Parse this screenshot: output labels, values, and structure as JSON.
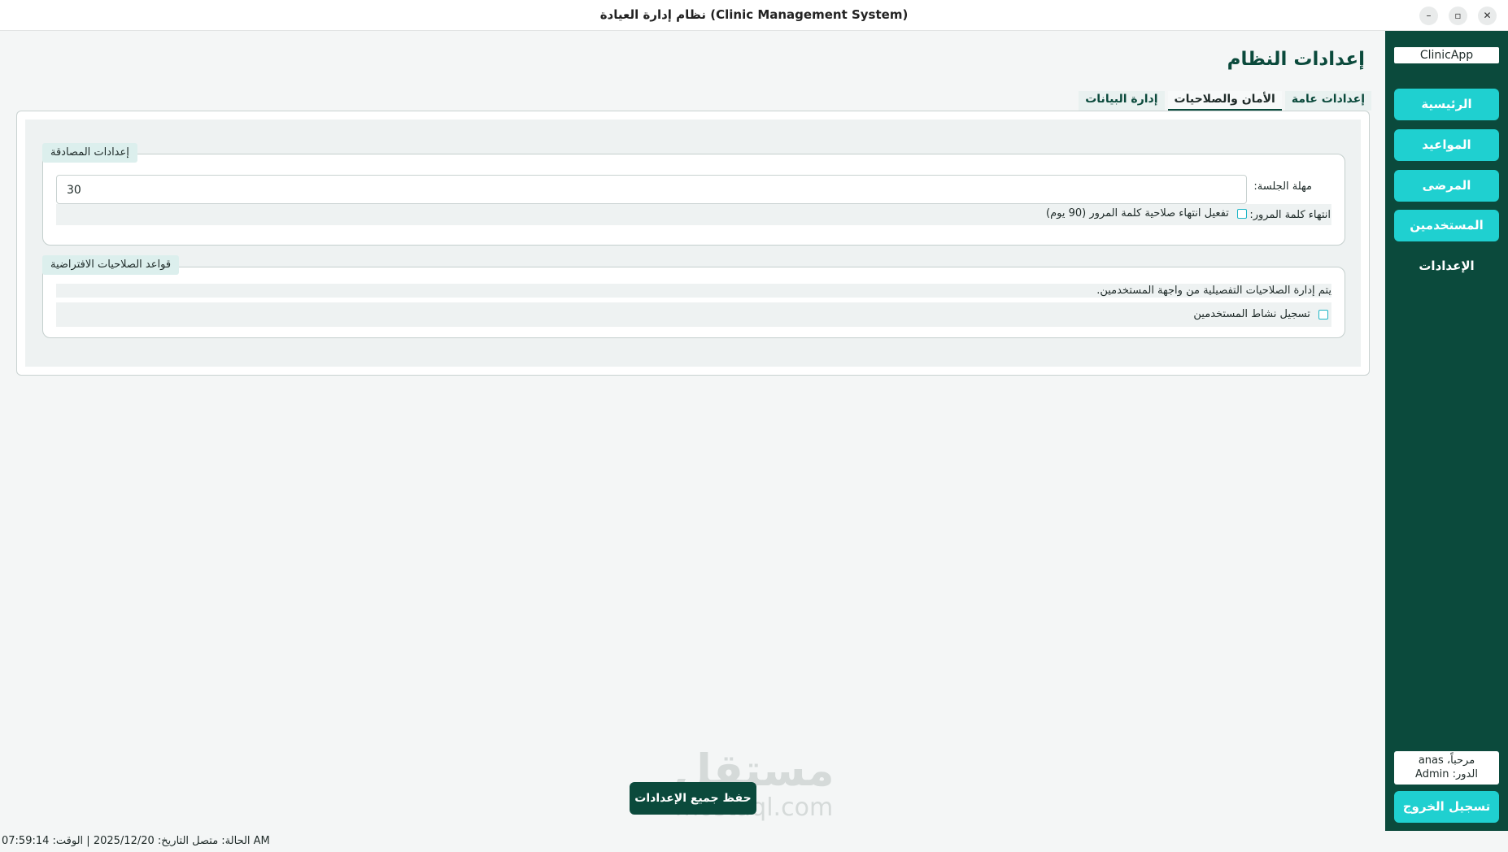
{
  "window": {
    "title": "نظام إدارة العيادة (Clinic Management System)",
    "minimize_glyph": "–",
    "maximize_glyph": "▫",
    "close_glyph": "✕"
  },
  "sidebar": {
    "brand": "ClinicApp",
    "items": [
      {
        "label": "الرئيسية"
      },
      {
        "label": "المواعيد"
      },
      {
        "label": "المرضى"
      },
      {
        "label": "المستخدمين"
      },
      {
        "label": "الإعدادات"
      }
    ],
    "user": {
      "welcome": "مرحباً، anas",
      "role": "الدور: Admin"
    },
    "logout_label": "تسجيل الخروج"
  },
  "page": {
    "title": "إعدادات النظام",
    "tabs": [
      {
        "label": "إعدادات عامة"
      },
      {
        "label": "الأمان والصلاحيات"
      },
      {
        "label": "إدارة البيانات"
      }
    ],
    "auth_group": {
      "legend": "إعدادات المصادقة",
      "session_label": "مهلة الجلسة:",
      "session_value": "30",
      "password_label": "انتهاء كلمة المرور:",
      "password_checkbox": "تفعيل انتهاء صلاحية كلمة المرور (90 يوم)"
    },
    "perm_group": {
      "legend": "قواعد الصلاحيات الافتراضية",
      "note": "يتم إدارة الصلاحيات التفصيلية من واجهة المستخدمين.",
      "activity_checkbox": "تسجيل نشاط المستخدمين"
    },
    "save_label": "حفظ جميع الإعدادات"
  },
  "watermark": {
    "arabic": "مستقل",
    "latin": "mostaql.com"
  },
  "statusbar": {
    "text": "الحالة: متصل  التاريخ: 2025/12/20  |  الوقت: 07:59:14 AM"
  },
  "colors": {
    "sidebar": "#0b4a3c",
    "accent": "#1fd0d0",
    "background": "#f4f6f6"
  }
}
